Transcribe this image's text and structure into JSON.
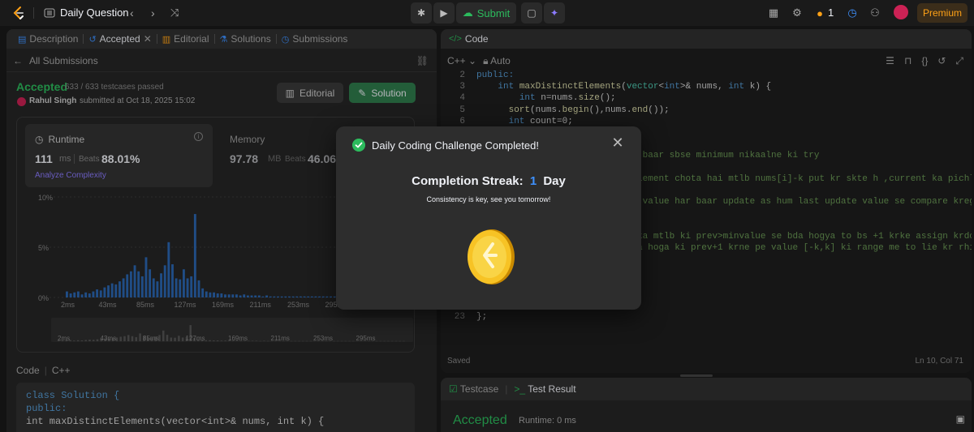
{
  "topbar": {
    "title": "Daily Question",
    "submit_label": "Submit",
    "streak_count": "1",
    "premium_label": "Premium"
  },
  "left": {
    "tabs": [
      {
        "label": "Description"
      },
      {
        "label": "Accepted"
      },
      {
        "label": "Editorial"
      },
      {
        "label": "Solutions"
      },
      {
        "label": "Submissions"
      }
    ],
    "all_submissions": "All Submissions",
    "status": "Accepted",
    "tests_passed": "633 / 633 testcases passed",
    "user": "Rahul Singh",
    "submitted_at": "submitted at Oct 18, 2025 15:02",
    "editorial_btn": "Editorial",
    "solution_btn": "Solution",
    "runtime": {
      "label": "Runtime",
      "value": "111",
      "unit": "ms",
      "beats_label": "Beats",
      "beats_value": "88.01%",
      "analyze": "Analyze Complexity"
    },
    "memory": {
      "label": "Memory",
      "value": "97.78",
      "unit": "MB",
      "beats_label": "Beats",
      "beats_value": "46.06%"
    },
    "code_label": "Code",
    "code_lang": "C++",
    "code_preview": [
      "class Solution {",
      "public:",
      "    int maxDistinctElements(vector<int>& nums, int k) {"
    ]
  },
  "chart_data": {
    "type": "bar",
    "ylabel_ticks": [
      "10%",
      "5%",
      "0%"
    ],
    "ylim": [
      0,
      10
    ],
    "x_ticks": [
      "2ms",
      "43ms",
      "85ms",
      "127ms",
      "169ms",
      "211ms",
      "253ms",
      "295ms"
    ],
    "values": [
      0.6,
      0.4,
      0.5,
      0.6,
      0.3,
      0.5,
      0.4,
      0.6,
      0.8,
      0.7,
      1.0,
      1.2,
      1.4,
      1.3,
      1.6,
      1.9,
      2.3,
      2.6,
      3.2,
      2.6,
      2.1,
      4.0,
      2.8,
      1.9,
      1.6,
      2.4,
      3.2,
      5.5,
      3.3,
      1.9,
      1.8,
      2.8,
      1.9,
      2.1,
      8.3,
      1.7,
      0.9,
      0.6,
      0.5,
      0.5,
      0.4,
      0.4,
      0.3,
      0.3,
      0.3,
      0.3,
      0.2,
      0.3,
      0.2,
      0.2,
      0.2,
      0.2,
      0.1,
      0.2,
      0.1,
      0.1,
      0.1,
      0.1,
      0.1,
      0.1,
      0.1,
      0.1,
      0.1,
      0.1,
      0.1,
      0.1,
      0.1,
      0.1,
      0.1,
      0.1,
      0.1,
      0.1,
      0.1,
      0.1,
      0.1,
      0.1,
      0.1,
      0.1,
      0.1,
      0.1,
      0.1,
      0.1,
      0.1,
      0.1,
      0.1,
      0.1,
      0.1,
      0.1,
      0.1,
      0.1
    ]
  },
  "editor": {
    "tab": "Code",
    "lang": "C++",
    "mode": "Auto",
    "saved": "Saved",
    "position": "Ln 10, Col 71"
  },
  "bottom": {
    "tab_testcase": "Testcase",
    "tab_result": "Test Result",
    "status": "Accepted",
    "runtime": "Runtime: 0 ms"
  },
  "modal": {
    "title": "Daily Coding Challenge Completed!",
    "streak_label": "Completion Streak:",
    "streak_value": "1",
    "streak_unit": "Day",
    "message": "Consistency is key, see you tomorrow!"
  }
}
